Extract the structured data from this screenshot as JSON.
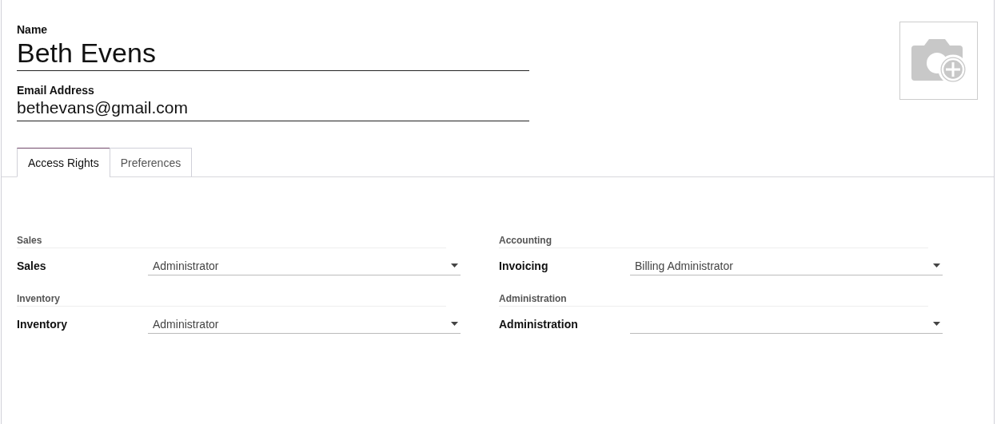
{
  "form": {
    "name_label": "Name",
    "name_value": "Beth Evens",
    "email_label": "Email Address",
    "email_value": "bethevans@gmail.com"
  },
  "tabs": [
    {
      "label": "Access Rights",
      "selected": true
    },
    {
      "label": "Preferences",
      "selected": false
    }
  ],
  "groups": [
    {
      "title": "Sales",
      "field": {
        "label": "Sales",
        "value": "Administrator"
      }
    },
    {
      "title": "Accounting",
      "field": {
        "label": "Invoicing",
        "value": "Billing Administrator"
      }
    },
    {
      "title": "Inventory",
      "field": {
        "label": "Inventory",
        "value": "Administrator"
      }
    },
    {
      "title": "Administration",
      "field": {
        "label": "Administration"
      }
    }
  ]
}
